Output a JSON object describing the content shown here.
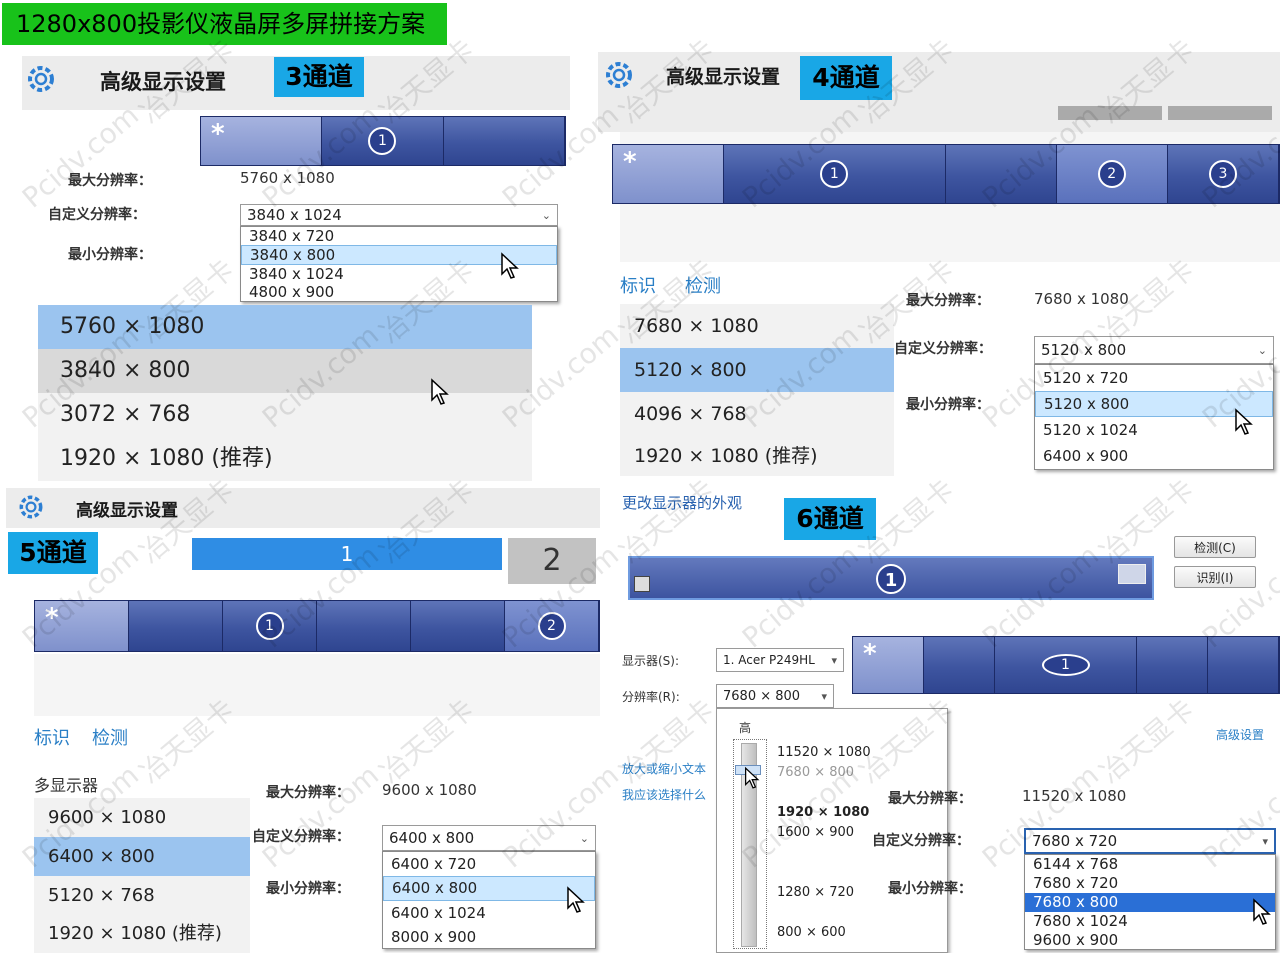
{
  "banner": "1280x800投影仪液晶屏多屏拼接方案",
  "common": {
    "adv_title": "高级显示设置",
    "max_label": "最大分辨率：",
    "custom_label": "自定义分辨率：",
    "min_label": "最小分辨率：",
    "tab_identify": "标识",
    "tab_detect": "检测",
    "star": "*"
  },
  "p3": {
    "badge": "3通道",
    "max_val": "5760 x 1080",
    "custom_val": "3840 x 1024",
    "options": [
      "3840 x 720",
      "3840 x 800",
      "3840 x 1024",
      "4800 x 900"
    ],
    "list": [
      "5760 × 1080",
      "3840 × 800",
      "3072 × 768",
      "1920 × 1080 (推荐)"
    ],
    "mon1": "1"
  },
  "p4": {
    "badge": "4通道",
    "max_val": "7680 x 1080",
    "custom_val": "5120 x 800",
    "options": [
      "5120 x 720",
      "5120 x 800",
      "5120 x 1024",
      "6400 x 900"
    ],
    "list": [
      "7680 × 1080",
      "5120 × 800",
      "4096 × 768",
      "1920 × 1080 (推荐)"
    ],
    "mon1": "1",
    "mon2": "2",
    "mon3": "3"
  },
  "p5": {
    "badge": "5通道",
    "mon1": "1",
    "mon2": "2",
    "mon_small1": "1",
    "mon_small2": "2",
    "list_header": "多显示器",
    "max_val": "9600 x 1080",
    "custom_val": "6400 x 800",
    "options": [
      "6400 x 720",
      "6400 x 800",
      "6400 x 1024",
      "8000 x 900"
    ],
    "list": [
      "9600 × 1080",
      "6400 × 800",
      "5120 × 768",
      "1920 × 1080 (推荐)"
    ]
  },
  "p6": {
    "badge": "6通道",
    "title": "更改显示器的外观",
    "detect_btn": "检测(C)",
    "identify_btn": "识别(I)",
    "mon1": "1",
    "display_label": "显示器(S):",
    "display_val": "1. Acer P249HL",
    "res_label": "分辨率(R):",
    "res_val": "7680 × 800",
    "slider_high": "高",
    "slider_items": [
      "11520 × 1080",
      "7680 × 800",
      "1920 × 1080",
      "1600 × 900",
      "1280 × 720",
      "800 × 600"
    ],
    "advanced_link": "高级设置",
    "link1": "放大或缩小文本",
    "link2": "我应该选择什么",
    "max_val": "11520 x 1080",
    "custom_val": "7680 x 720",
    "options": [
      "6144 x 768",
      "7680 x 720",
      "7680 x 800",
      "7680 x 1024",
      "9600 x 900"
    ]
  },
  "watermarks": [
    "Pcidv.com",
    "冶天显卡"
  ]
}
